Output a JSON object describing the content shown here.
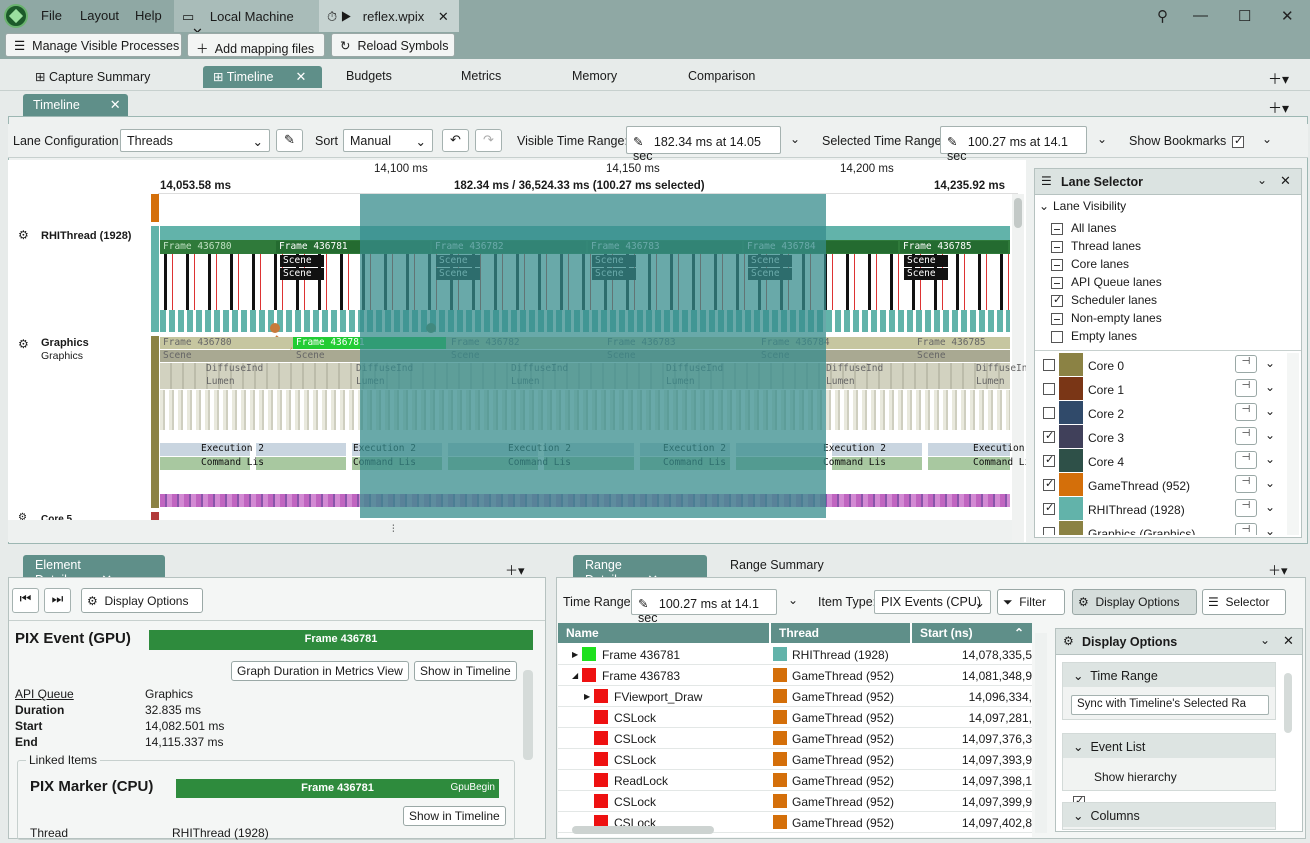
{
  "menu": {
    "file": "File",
    "layout": "Layout",
    "help": "Help"
  },
  "doc_tabs": [
    {
      "label": "Local Machine"
    },
    {
      "label": "reflex.wpix"
    }
  ],
  "toolbar": {
    "manage": "Manage Visible Processes",
    "add_mapping": "Add mapping files",
    "reload": "Reload Symbols"
  },
  "main_tabs": [
    "Capture Summary",
    "Timeline",
    "Budgets",
    "Metrics",
    "Memory",
    "Comparison"
  ],
  "sub_tab": "Timeline",
  "controls": {
    "lane_config_label": "Lane Configuration",
    "lane_config_value": "Threads",
    "sort_label": "Sort",
    "sort_value": "Manual",
    "visible_range_label": "Visible Time Range:",
    "visible_range_value": "182.34 ms at 14.05 sec",
    "selected_range_label": "Selected Time Range:",
    "selected_range_value": "100.27 ms at 14.1 sec",
    "bookmarks_label": "Show Bookmarks"
  },
  "ruler": {
    "t1": "14,100 ms",
    "t2": "14,150 ms",
    "t3": "14,200 ms",
    "left": "14,053.58 ms",
    "center": "182.34 ms / 36,524.33 ms (100.27 ms selected)",
    "right": "14,235.92 ms"
  },
  "lanes": {
    "rhi": "RHIThread (1928)",
    "graphics": "Graphics",
    "graphics_sub": "Graphics",
    "core5": "Core 5"
  },
  "rhi_frames": [
    "Frame 436780",
    "Frame 436781",
    "Frame 436782",
    "Frame 436783",
    "Frame 436784",
    "Frame 436785"
  ],
  "gfx_frames": [
    "Frame 436780",
    "Frame 436781",
    "Frame 436782",
    "Frame 436783",
    "Frame 436784",
    "Frame 436785"
  ],
  "labels": {
    "scene": "Scene",
    "diffuse": "DiffuseInd",
    "lumen": "Lumen",
    "exec": "Execution 2",
    "cmd": "Command Lis"
  },
  "lane_selector": {
    "title": "Lane Selector",
    "visibility": "Lane Visibility",
    "options": [
      {
        "label": "All lanes",
        "state": "part"
      },
      {
        "label": "Thread lanes",
        "state": "part"
      },
      {
        "label": "Core lanes",
        "state": "part"
      },
      {
        "label": "API Queue lanes",
        "state": "part"
      },
      {
        "label": "Scheduler lanes",
        "state": "on"
      },
      {
        "label": "Non-empty lanes",
        "state": "part"
      },
      {
        "label": "Empty lanes",
        "state": "off"
      }
    ],
    "cores": [
      {
        "name": "Core 0",
        "color": "#8b8244",
        "on": false
      },
      {
        "name": "Core 1",
        "color": "#7a3616",
        "on": false
      },
      {
        "name": "Core 2",
        "color": "#304a6a",
        "on": false
      },
      {
        "name": "Core 3",
        "color": "#40405a",
        "on": true
      },
      {
        "name": "Core 4",
        "color": "#2e5048",
        "on": true
      },
      {
        "name": "GameThread (952)",
        "color": "#d46f0a",
        "on": true
      },
      {
        "name": "RHIThread (1928)",
        "color": "#62b3aa",
        "on": true
      },
      {
        "name": "Graphics (Graphics)",
        "color": "#8b8244",
        "on": false
      }
    ]
  },
  "element_details": {
    "tab": "Element Details",
    "display_options": "Display Options",
    "title": "PIX Event (GPU)",
    "bar": "Frame 436781",
    "graph_btn": "Graph Duration in Metrics View",
    "show_btn": "Show in Timeline",
    "rows": [
      {
        "k": "API Queue",
        "v": "Graphics"
      },
      {
        "k": "Duration",
        "v": "32.835 ms"
      },
      {
        "k": "Start",
        "v": "14,082.501 ms"
      },
      {
        "k": "End",
        "v": "14,115.337 ms"
      }
    ],
    "linked": "Linked Items",
    "marker_title": "PIX Marker (CPU)",
    "marker_bar": "Frame 436781",
    "marker_tag": "GpuBegin",
    "marker_show": "Show in Timeline",
    "thread_k": "Thread",
    "thread_v": "RHIThread (1928)"
  },
  "range": {
    "tab1": "Range Details",
    "tab2": "Range Summary",
    "time_range_label": "Time Range:",
    "time_range_value": "100.27 ms at 14.1 sec",
    "item_type_label": "Item Type:",
    "item_type_value": "PIX Events (CPU)",
    "filter": "Filter",
    "display": "Display Options",
    "selector": "Selector",
    "cols": [
      "Name",
      "Thread",
      "Start (ns)"
    ],
    "rows": [
      {
        "name": "Frame 436781",
        "color": "#1ee01e",
        "thread": "RHIThread (1928)",
        "tcolor": "#62b3aa",
        "start": "14,078,335,5",
        "exp": "right",
        "ind": 0
      },
      {
        "name": "Frame 436783",
        "color": "#ee1111",
        "thread": "GameThread (952)",
        "tcolor": "#d46f0a",
        "start": "14,081,348,9",
        "exp": "down",
        "ind": 0
      },
      {
        "name": "FViewport_Draw",
        "color": "#ee1111",
        "thread": "GameThread (952)",
        "tcolor": "#d46f0a",
        "start": "14,096,334,",
        "exp": "right",
        "ind": 1
      },
      {
        "name": "CSLock",
        "color": "#ee1111",
        "thread": "GameThread (952)",
        "tcolor": "#d46f0a",
        "start": "14,097,281,",
        "exp": "",
        "ind": 1
      },
      {
        "name": "CSLock",
        "color": "#ee1111",
        "thread": "GameThread (952)",
        "tcolor": "#d46f0a",
        "start": "14,097,376,3",
        "exp": "",
        "ind": 1
      },
      {
        "name": "CSLock",
        "color": "#ee1111",
        "thread": "GameThread (952)",
        "tcolor": "#d46f0a",
        "start": "14,097,393,9",
        "exp": "",
        "ind": 1
      },
      {
        "name": "ReadLock",
        "color": "#ee1111",
        "thread": "GameThread (952)",
        "tcolor": "#d46f0a",
        "start": "14,097,398,1",
        "exp": "",
        "ind": 1
      },
      {
        "name": "CSLock",
        "color": "#ee1111",
        "thread": "GameThread (952)",
        "tcolor": "#d46f0a",
        "start": "14,097,399,9",
        "exp": "",
        "ind": 1
      },
      {
        "name": "CSLock",
        "color": "#ee1111",
        "thread": "GameThread (952)",
        "tcolor": "#d46f0a",
        "start": "14,097,402,8",
        "exp": "",
        "ind": 1
      }
    ]
  },
  "display_options": {
    "title": "Display Options",
    "time_range": "Time Range",
    "sync": "Sync with Timeline's Selected Ra",
    "event_list": "Event List",
    "hierarchy": "Show hierarchy",
    "columns": "Columns"
  }
}
